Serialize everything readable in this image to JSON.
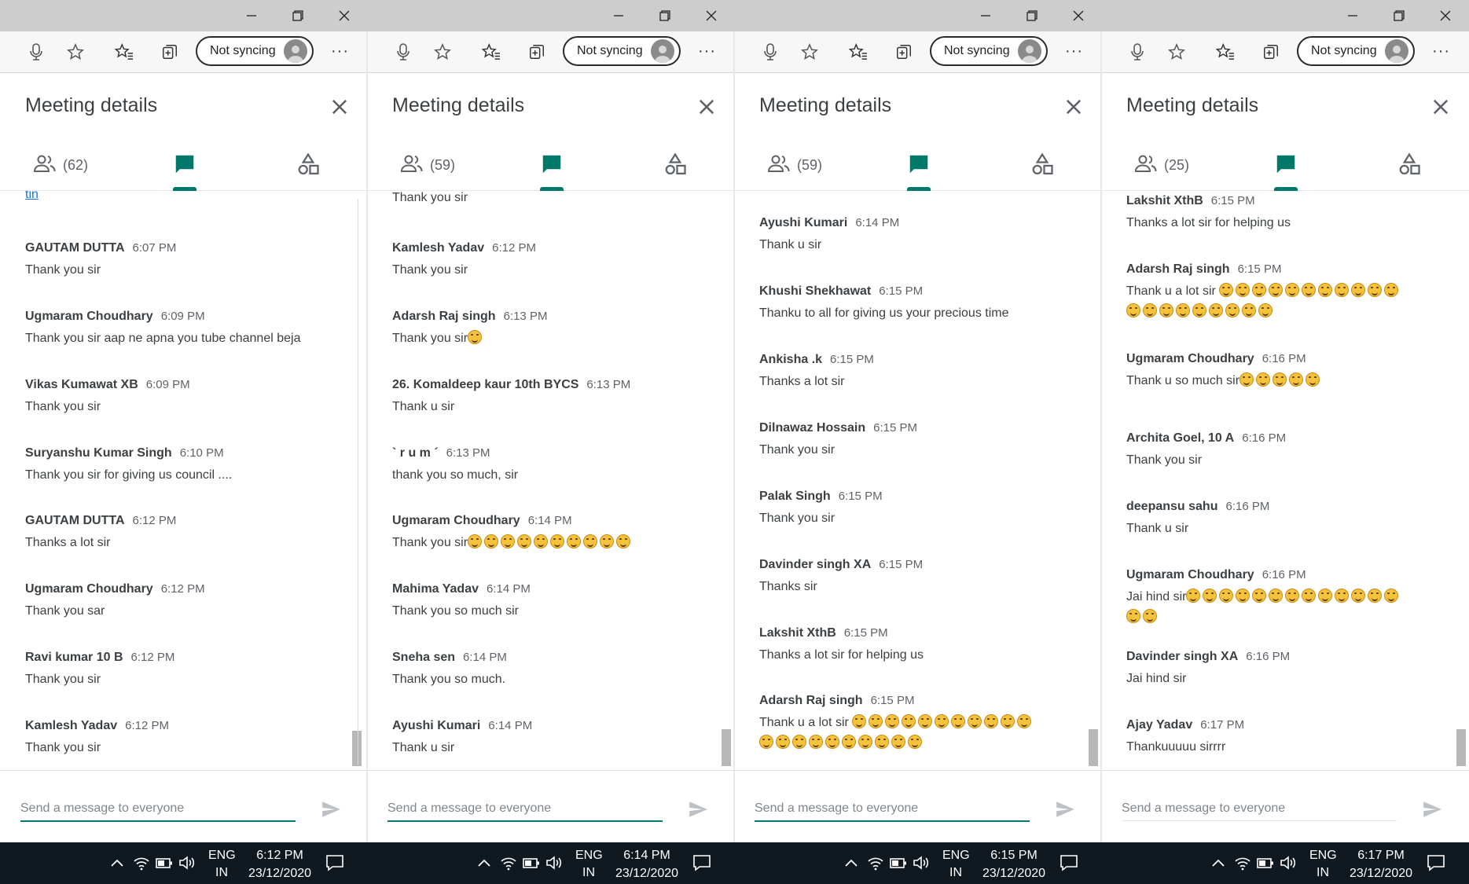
{
  "browser": {
    "sync_label": "Not syncing",
    "more_label": "···"
  },
  "meeting": {
    "title": "Meeting details",
    "compose_placeholder": "Send a message to everyone"
  },
  "colors": {
    "accent": "#00796b",
    "link": "#1a73e8",
    "taskbar": "#101820"
  },
  "icons": [
    "microphone-icon",
    "star-icon",
    "favorites-icon",
    "collections-icon",
    "profile-icon",
    "close-icon",
    "people-icon",
    "chat-icon",
    "activities-icon",
    "send-icon",
    "smiley-emoji",
    "wifi-icon",
    "battery-icon",
    "volume-icon",
    "notifications-icon"
  ],
  "panels": [
    {
      "participants": "(62)",
      "link_fragment": "tin",
      "taskbar": {
        "lang": "ENG",
        "region": "IN",
        "time": "6:12 PM",
        "date": "23/12/2020"
      },
      "messages": [
        {
          "name": "GAUTAM DUTTA",
          "time": "6:07 PM",
          "lines": [
            {
              "text": "Thank you sir",
              "emoji": 0
            }
          ]
        },
        {
          "name": "Ugmaram Choudhary",
          "time": "6:09 PM",
          "lines": [
            {
              "text": "Thank you sir aap ne apna you tube channel beja",
              "emoji": 0
            }
          ]
        },
        {
          "name": "Vikas Kumawat XB",
          "time": "6:09 PM",
          "lines": [
            {
              "text": "Thank you sir",
              "emoji": 0
            }
          ]
        },
        {
          "name": "Suryanshu Kumar Singh",
          "time": "6:10 PM",
          "lines": [
            {
              "text": "Thank you sir for giving us council ....",
              "emoji": 0
            }
          ]
        },
        {
          "name": "GAUTAM DUTTA",
          "time": "6:12 PM",
          "lines": [
            {
              "text": "Thanks a lot sir",
              "emoji": 0
            }
          ]
        },
        {
          "name": "Ugmaram Choudhary",
          "time": "6:12 PM",
          "lines": [
            {
              "text": "Thank  you sar",
              "emoji": 0
            }
          ]
        },
        {
          "name": "Ravi kumar 10 B",
          "time": "6:12 PM",
          "lines": [
            {
              "text": "Thank you sir",
              "emoji": 0
            }
          ]
        },
        {
          "name": "Kamlesh Yadav",
          "time": "6:12 PM",
          "lines": [
            {
              "text": "Thank you sir",
              "emoji": 0
            }
          ]
        }
      ]
    },
    {
      "participants": "(59)",
      "partial_text": "Thank you sir",
      "taskbar": {
        "lang": "ENG",
        "region": "IN",
        "time": "6:14 PM",
        "date": "23/12/2020"
      },
      "messages": [
        {
          "name": "Kamlesh Yadav",
          "time": "6:12 PM",
          "lines": [
            {
              "text": "Thank you sir",
              "emoji": 0
            }
          ]
        },
        {
          "name": "Adarsh Raj singh",
          "time": "6:13 PM",
          "lines": [
            {
              "text": "Thank you sir",
              "emoji": 1
            }
          ]
        },
        {
          "name": "26. Komaldeep kaur 10th BYCS",
          "time": "6:13 PM",
          "lines": [
            {
              "text": "Thank u sir",
              "emoji": 0
            }
          ]
        },
        {
          "name": "` r u m ´",
          "time": "6:13 PM",
          "lines": [
            {
              "text": "thank you so much, sir",
              "emoji": 0
            }
          ]
        },
        {
          "name": "Ugmaram Choudhary",
          "time": "6:14 PM",
          "lines": [
            {
              "text": "Thank you sir",
              "emoji": 10
            }
          ]
        },
        {
          "name": "Mahima Yadav",
          "time": "6:14 PM",
          "lines": [
            {
              "text": "Thank you so much  sir",
              "emoji": 0
            }
          ]
        },
        {
          "name": "Sneha sen",
          "time": "6:14 PM",
          "lines": [
            {
              "text": "Thank you so much.",
              "emoji": 0
            }
          ]
        },
        {
          "name": "Ayushi Kumari",
          "time": "6:14 PM",
          "lines": [
            {
              "text": "Thank u sir",
              "emoji": 0
            }
          ]
        }
      ]
    },
    {
      "participants": "(59)",
      "taskbar": {
        "lang": "ENG",
        "region": "IN",
        "time": "6:15 PM",
        "date": "23/12/2020"
      },
      "messages": [
        {
          "name": "Ayushi Kumari",
          "time": "6:14 PM",
          "lines": [
            {
              "text": "Thank u sir",
              "emoji": 0
            }
          ]
        },
        {
          "name": "Khushi Shekhawat",
          "time": "6:15 PM",
          "lines": [
            {
              "text": "Thanku to all for giving us your precious time",
              "emoji": 0
            }
          ]
        },
        {
          "name": "Ankisha .k",
          "time": "6:15 PM",
          "lines": [
            {
              "text": "Thanks a lot sir",
              "emoji": 0
            }
          ]
        },
        {
          "name": "Dilnawaz Hossain",
          "time": "6:15 PM",
          "lines": [
            {
              "text": "Thank you sir",
              "emoji": 0
            }
          ]
        },
        {
          "name": "Palak Singh",
          "time": "6:15 PM",
          "lines": [
            {
              "text": "Thank you sir",
              "emoji": 0
            }
          ]
        },
        {
          "name": "Davinder singh XA",
          "time": "6:15 PM",
          "lines": [
            {
              "text": "Thanks sir",
              "emoji": 0
            }
          ]
        },
        {
          "name": "Lakshit XthB",
          "time": "6:15 PM",
          "lines": [
            {
              "text": "Thanks a lot sir for helping us",
              "emoji": 0
            }
          ]
        },
        {
          "name": "Adarsh Raj singh",
          "time": "6:15 PM",
          "lines": [
            {
              "text": "Thank u a lot sir ",
              "emoji": 11
            },
            {
              "text": "",
              "emoji": 10
            }
          ]
        }
      ]
    },
    {
      "participants": "(25)",
      "taskbar": {
        "lang": "ENG",
        "region": "IN",
        "time": "6:17 PM",
        "date": "23/12/2020"
      },
      "messages": [
        {
          "name": "Lakshit XthB",
          "time": "6:15 PM",
          "lines": [
            {
              "text": "Thanks a lot sir for helping us",
              "emoji": 0
            }
          ]
        },
        {
          "name": "Adarsh Raj singh",
          "time": "6:15 PM",
          "lines": [
            {
              "text": "Thank u a lot sir ",
              "emoji": 11
            },
            {
              "text": "",
              "emoji": 9
            }
          ]
        },
        {
          "name": "Ugmaram Choudhary",
          "time": "6:16 PM",
          "lines": [
            {
              "text": "Thank u so much sir",
              "emoji": 5
            }
          ]
        },
        {
          "name": "Archita Goel, 10 A",
          "time": "6:16 PM",
          "lines": [
            {
              "text": "Thank you sir",
              "emoji": 0
            }
          ]
        },
        {
          "name": "deepansu sahu",
          "time": "6:16 PM",
          "lines": [
            {
              "text": "Thank u sir",
              "emoji": 0
            }
          ]
        },
        {
          "name": "Ugmaram Choudhary",
          "time": "6:16 PM",
          "lines": [
            {
              "text": "Jai hind sir",
              "emoji": 13
            },
            {
              "text": "",
              "emoji": 2
            }
          ]
        },
        {
          "name": "Davinder singh XA",
          "time": "6:16 PM",
          "lines": [
            {
              "text": "Jai hind sir",
              "emoji": 0
            }
          ]
        },
        {
          "name": "Ajay Yadav",
          "time": "6:17 PM",
          "lines": [
            {
              "text": "Thankuuuuu sirrrr",
              "emoji": 0
            }
          ]
        }
      ]
    }
  ]
}
